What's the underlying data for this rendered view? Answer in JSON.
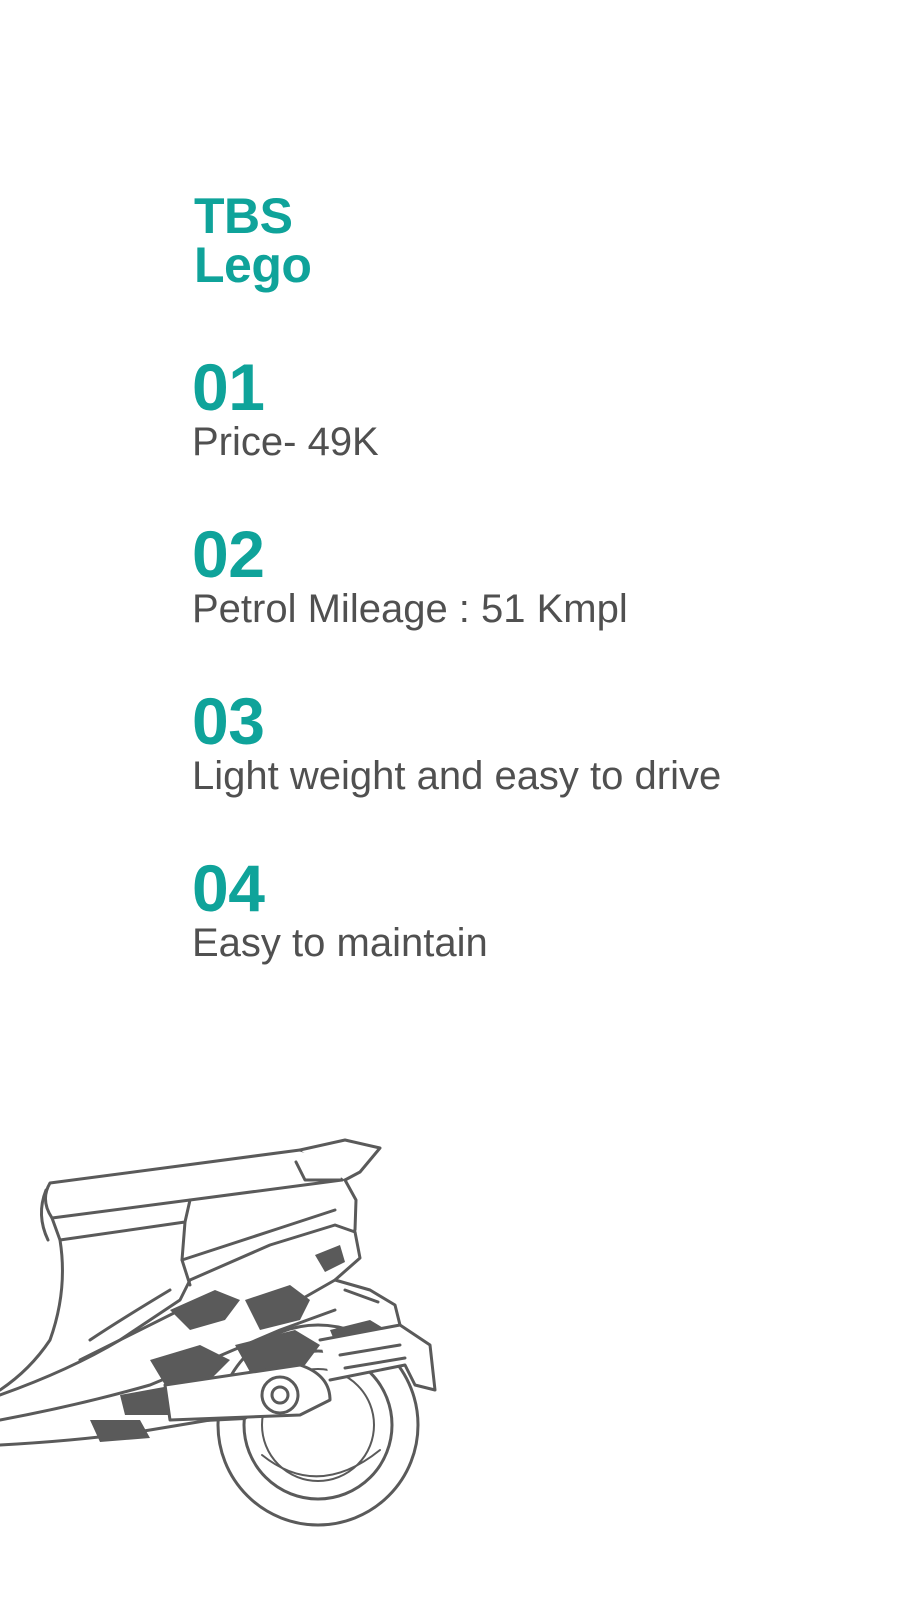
{
  "brand": {
    "line1": "TBS",
    "line2": "Lego"
  },
  "features": [
    {
      "number": "01",
      "text": "Price- 49K"
    },
    {
      "number": "02",
      "text": "Petrol Mileage : 51 Kmpl"
    },
    {
      "number": "03",
      "text": "Light weight and easy to drive"
    },
    {
      "number": "04",
      "text": "Easy to maintain"
    }
  ],
  "colors": {
    "accent": "#0fa39a",
    "text": "#505050",
    "illustration": "#5a5a5a",
    "background": "#ffffff"
  },
  "illustration": "scooter-sketch"
}
